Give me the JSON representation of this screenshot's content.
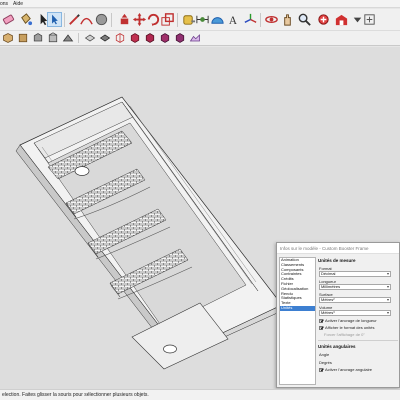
{
  "menubar": {
    "items": [
      "ons",
      "Aide"
    ]
  },
  "toolbar1": {
    "icons": [
      "eraser-icon",
      "paint-bucket-icon",
      "select-arrow-icon",
      "pencil-line-icon",
      "arc-icon",
      "shape-icon",
      "push-pull-icon",
      "move-icon",
      "rotate-icon",
      "scale-icon",
      "offset-icon",
      "tape-measure-icon",
      "dimension-icon",
      "protractor-icon",
      "text-icon",
      "axes-icon",
      "section-plane-icon",
      "orbit-icon",
      "pan-icon",
      "zoom-icon",
      "zoom-extents-icon",
      "warehouse-icon",
      "extension-icon"
    ]
  },
  "toolbar2": {
    "icons": [
      "iso-view-icon",
      "top-view-icon",
      "front-view-icon",
      "right-view-icon",
      "back-view-icon",
      "left-view-icon",
      "xray-icon",
      "back-edges-icon",
      "wireframe-icon",
      "hidden-line-icon",
      "shaded-icon",
      "shaded-texture-icon",
      "monochrome-icon",
      "sandbox-icon"
    ]
  },
  "status": {
    "text": "election. Faites glisser la souris pour sélectionner plusieurs objets."
  },
  "dialog": {
    "title": "Infos sur le modèle - Custom Booster Frame",
    "sidebar_items": [
      "Animation",
      "Classements",
      "Composants",
      "Contraintes",
      "Crédits",
      "Fichier",
      "Géolocalisation",
      "Rendu",
      "Statistiques",
      "Texte",
      "Unités"
    ],
    "selected_item": "Unités",
    "units_section": {
      "heading": "Unités de mesure",
      "format_label": "Format",
      "format_value": "Décimal",
      "length_label": "Longueur",
      "length_value": "Millimètres",
      "area_label": "Surface",
      "area_value": "Mètres²",
      "volume_label": "Volume",
      "volume_value": "Mètres³",
      "snap_length_label": "Activer l'ancrage de longueur",
      "snap_length_checked": true,
      "show_unit_label": "Afficher le format des unités",
      "show_unit_checked": true,
      "force_display_label": "Forcer l'affichage de 0\""
    },
    "angle_section": {
      "heading": "Unités angulaires",
      "angle_label": "Angle",
      "degrees_label": "Degrés",
      "snap_angle_label": "Activer l'ancrage angulaire",
      "snap_angle_checked": true
    }
  }
}
